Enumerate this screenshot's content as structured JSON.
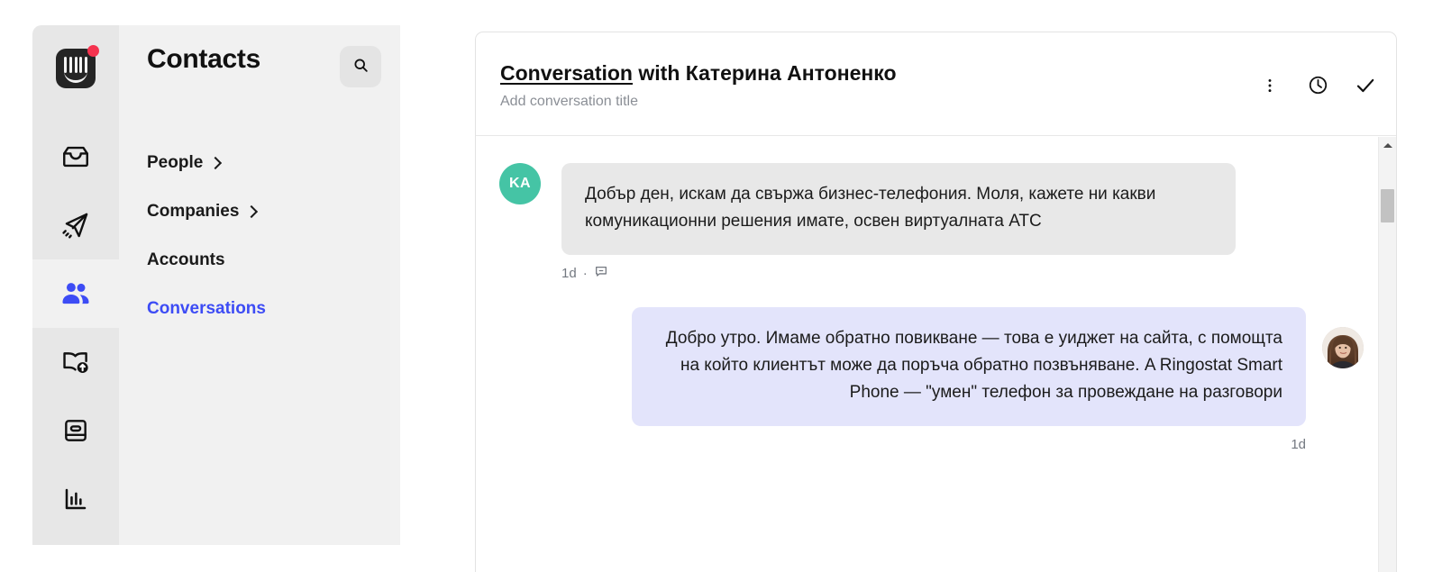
{
  "app": {
    "logo_icon": "intercom-logo-icon",
    "notification_dot": true
  },
  "rail": {
    "items": [
      {
        "name": "inbox",
        "icon": "inbox-icon",
        "active": false
      },
      {
        "name": "send",
        "icon": "paper-plane-icon",
        "active": false
      },
      {
        "name": "contacts",
        "icon": "people-icon",
        "active": true
      },
      {
        "name": "knowledge",
        "icon": "book-upload-icon",
        "active": false
      },
      {
        "name": "messages",
        "icon": "card-icon",
        "active": false
      },
      {
        "name": "reports",
        "icon": "bar-chart-icon",
        "active": false
      }
    ]
  },
  "contacts": {
    "title": "Contacts",
    "search_icon": "search-icon",
    "nav": [
      {
        "label": "People",
        "chevron": true,
        "active": false
      },
      {
        "label": "Companies",
        "chevron": true,
        "active": false
      },
      {
        "label": "Accounts",
        "chevron": false,
        "active": false
      },
      {
        "label": "Conversations",
        "chevron": false,
        "active": true
      }
    ]
  },
  "conversation": {
    "title_link": "Conversation",
    "title_rest": " with Катерина Антоненко",
    "subtitle": "Add conversation title",
    "actions": [
      {
        "name": "more-options",
        "icon": "kebab-menu-icon"
      },
      {
        "name": "snooze",
        "icon": "clock-icon"
      },
      {
        "name": "close-conversation",
        "icon": "check-icon"
      }
    ],
    "messages": [
      {
        "direction": "in",
        "avatar_initials": "KA",
        "avatar_color": "#45c4a5",
        "text": "Добър ден, искам да свържа бизнес-телефония. Моля, кажете ни какви комуникационни решения имате, освен виртуалната АТС",
        "time": "1d",
        "meta_separator": "·",
        "meta_icon": "chat-bubble-icon"
      },
      {
        "direction": "out",
        "avatar_photo": true,
        "text": "Добро утро. Имаме обратно повикване — това е уиджет на сайта, с помощта на който клиентът може да поръча обратно позвъняване. A Ringostat Smart Phone — \"умен\" телефон за провеждане на разговори",
        "time": "1d"
      }
    ]
  },
  "scrollbar": {
    "up_arrow_icon": "scroll-up-arrow-icon",
    "thumb": "scrollbar-thumb"
  },
  "colors": {
    "accent_blue": "#3d4cf5",
    "bubble_in": "#e8e8e8",
    "bubble_out": "#e3e4fb",
    "rail_bg": "#e7e7e7",
    "panel_bg": "#f1f1f1",
    "notification_red": "#f5334f"
  }
}
